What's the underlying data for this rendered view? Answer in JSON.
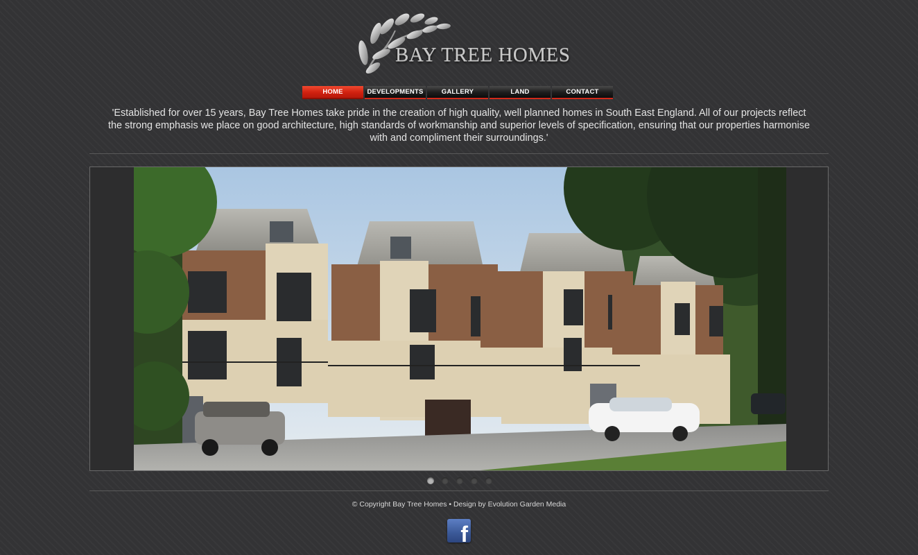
{
  "brand": {
    "name": "BAY TREE HOMES",
    "logo_icon": "leaf-branch-icon"
  },
  "nav": {
    "items": [
      {
        "label": "HOME",
        "active": true
      },
      {
        "label": "DEVELOPMENTS",
        "active": false
      },
      {
        "label": "GALLERY",
        "active": false
      },
      {
        "label": "LAND",
        "active": false
      },
      {
        "label": "CONTACT",
        "active": false
      }
    ]
  },
  "intro": {
    "text": "'Established for over 15 years, Bay Tree Homes take pride in the creation of high quality, well planned homes in South East England. All of our projects reflect the strong emphasis we place on good architecture, high standards of workmanship and superior levels of specification, ensuring that our properties harmonise with and compliment their surroundings.'"
  },
  "slider": {
    "slide_count": 5,
    "active_index": 0
  },
  "footer": {
    "copyright": "© Copyright Bay Tree Homes • Design by Evolution Garden Media"
  },
  "social": {
    "facebook_icon": "facebook-icon",
    "facebook_letter": "f"
  },
  "colors": {
    "accent_red": "#d0210f",
    "background": "#333335",
    "facebook_blue": "#3b5998"
  }
}
